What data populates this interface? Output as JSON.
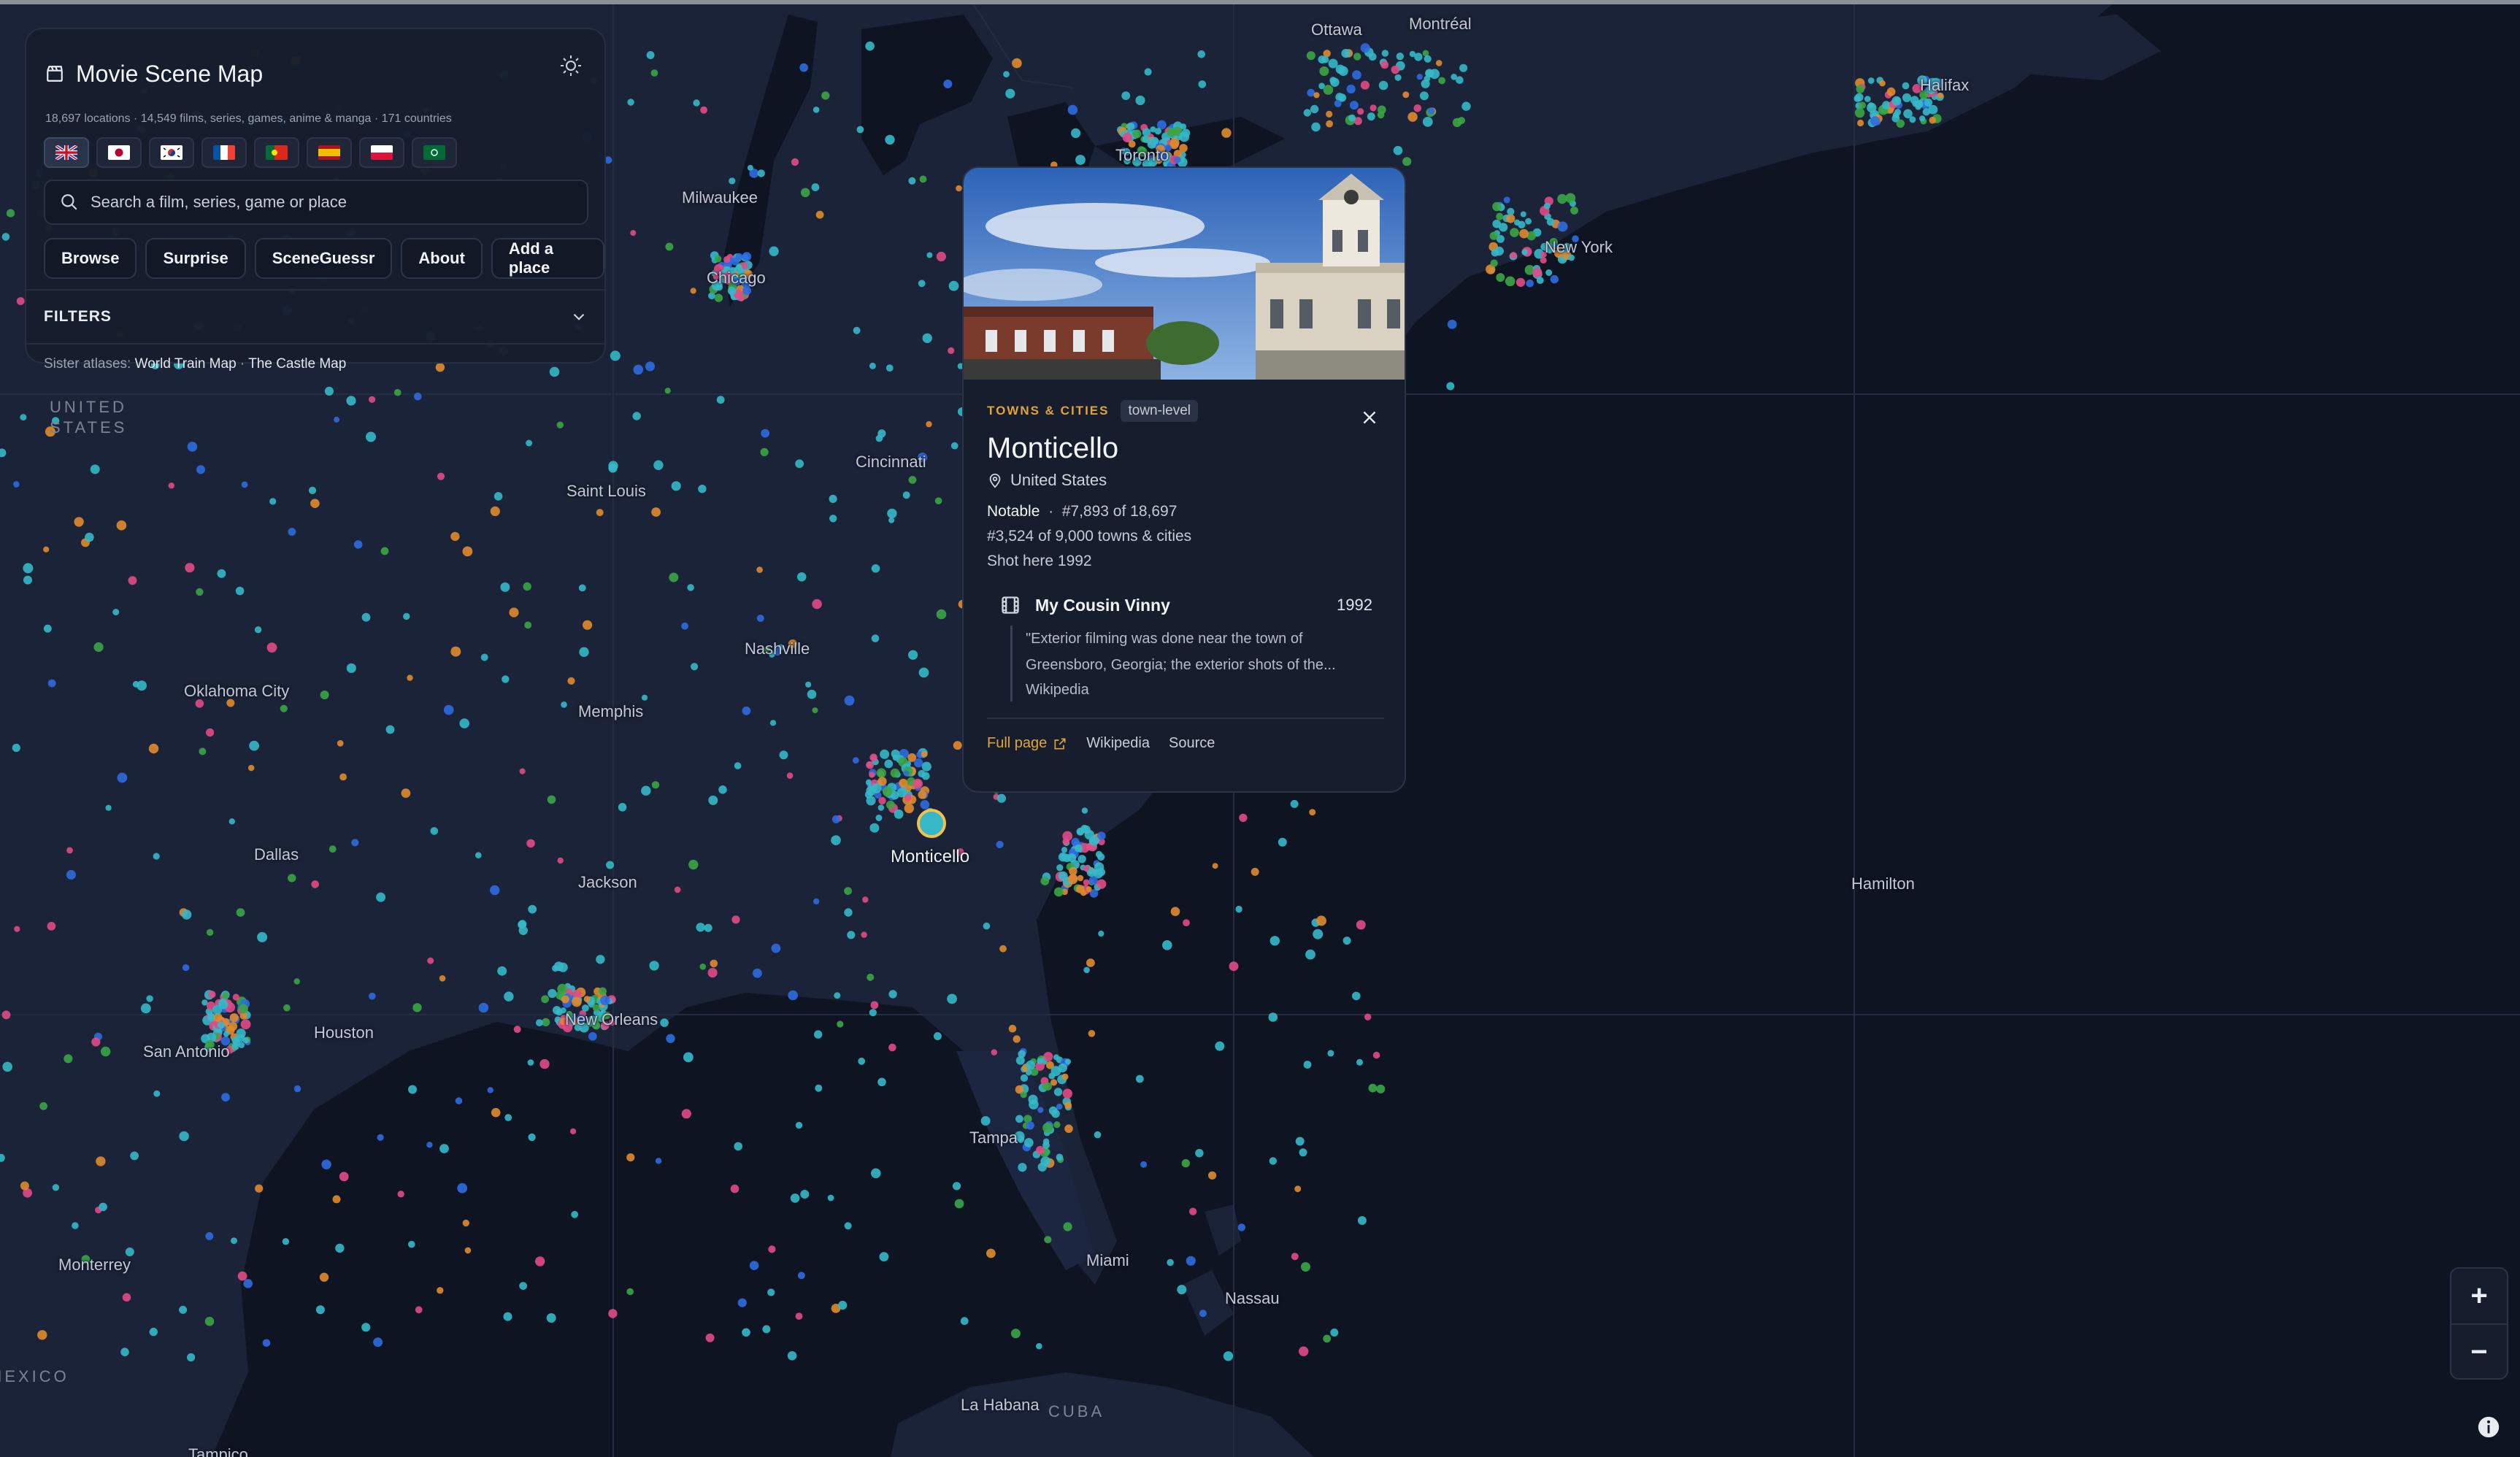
{
  "app": {
    "title": "Movie Scene Map",
    "stats": "18,697 locations · 14,549 films, series, games, anime & manga · 171 countries",
    "theme_icon": "sun-icon",
    "flags": [
      {
        "name": "flag-uk",
        "active": true
      },
      {
        "name": "flag-japan"
      },
      {
        "name": "flag-korea"
      },
      {
        "name": "flag-france"
      },
      {
        "name": "flag-portugal"
      },
      {
        "name": "flag-spain"
      },
      {
        "name": "flag-poland"
      },
      {
        "name": "flag-saudi-arabia"
      }
    ],
    "search_placeholder": "Search a film, series, game or place",
    "buttons": {
      "browse": "Browse",
      "surprise": "Surprise",
      "sceneguessr": "SceneGuessr",
      "about": "About",
      "add_place": "Add a place"
    },
    "filters_label": "FILTERS",
    "sister_prefix": "Sister atlases:",
    "sister_links": [
      "World Train Map",
      "The Castle Map"
    ],
    "sister_sep": "·"
  },
  "popup": {
    "category": "TOWNS & CITIES",
    "tag": "town-level",
    "name": "Monticello",
    "country": "United States",
    "notable": "Notable",
    "rank_sep": "·",
    "rank": "#7,893 of 18,697",
    "rank_category": "#3,524 of 9,000 towns & cities",
    "shot": "Shot here 1992",
    "film_title": "My Cousin Vinny",
    "film_year": "1992",
    "quote": "\"Exterior filming was done near the town of Greensboro, Georgia; the exterior shots of the...",
    "quote_source": "Wikipedia",
    "links": {
      "full_page": "Full page",
      "wikipedia": "Wikipedia",
      "source": "Source"
    }
  },
  "map": {
    "labels": {
      "ottawa": "Ottawa",
      "montreal": "Montréal",
      "halifax": "Halifax",
      "toronto": "Toronto",
      "milwaukee": "Milwaukee",
      "chicago": "Chicago",
      "united_states": "UNITED STATES",
      "saint_louis": "Saint Louis",
      "cincinnati": "Cincinnati",
      "nashville": "Nashville",
      "oklahoma_city": "Oklahoma City",
      "memphis": "Memphis",
      "dallas": "Dallas",
      "jackson": "Jackson",
      "monticello": "Monticello",
      "hamilton": "Hamilton",
      "new_orleans": "New Orleans",
      "houston": "Houston",
      "san_antonio": "San Antonio",
      "tampa": "Tampa",
      "miami": "Miami",
      "nassau": "Nassau",
      "monterrey": "Monterrey",
      "mexico": "MEXICO",
      "la_habana": "La Habana",
      "cuba": "CUBA",
      "tampico": "Tampico",
      "new_york": "New York"
    },
    "zoom_in": "+",
    "zoom_out": "−"
  },
  "colors": {
    "accent": "#e2a43a",
    "dot_teal": "#35b8c8",
    "dot_blue": "#2f6be0",
    "dot_green": "#3aa545",
    "dot_orange": "#e08a2c",
    "dot_pink": "#e24a86"
  }
}
